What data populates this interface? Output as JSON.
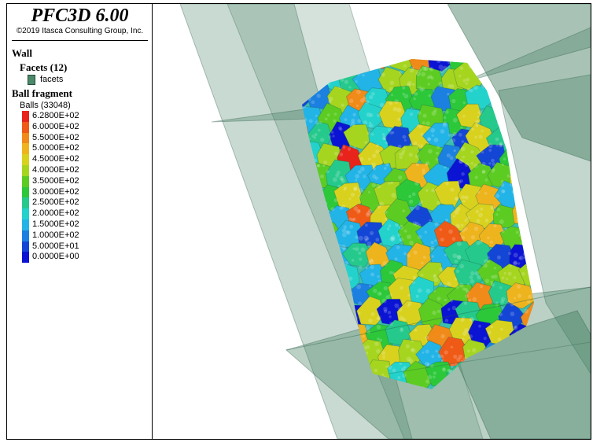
{
  "title": "PFC3D 6.00",
  "copyright": "©2019 Itasca Consulting Group, Inc.",
  "legend": {
    "wall_heading": "Wall",
    "facets_heading": "Facets (12)",
    "facets_label": "facets",
    "facets_color": "#4a8a6a",
    "fragment_heading": "Ball fragment",
    "balls_count": "Balls (33048)",
    "scale": [
      {
        "label": "6.2800E+02",
        "color": "#e8231c"
      },
      {
        "label": "6.0000E+02",
        "color": "#ef5a16"
      },
      {
        "label": "5.5000E+02",
        "color": "#f08a18"
      },
      {
        "label": "5.0000E+02",
        "color": "#eeb41d"
      },
      {
        "label": "4.5000E+02",
        "color": "#d8d21f"
      },
      {
        "label": "4.0000E+02",
        "color": "#a6d51f"
      },
      {
        "label": "3.5000E+02",
        "color": "#5ccc22"
      },
      {
        "label": "3.0000E+02",
        "color": "#2cc83a"
      },
      {
        "label": "2.5000E+02",
        "color": "#25c98c"
      },
      {
        "label": "2.0000E+02",
        "color": "#24d2cc"
      },
      {
        "label": "1.5000E+02",
        "color": "#22b4e6"
      },
      {
        "label": "1.0000E+02",
        "color": "#1b80e0"
      },
      {
        "label": "5.0000E+01",
        "color": "#1446d6"
      },
      {
        "label": "0.0000E+00",
        "color": "#0a14d2"
      }
    ]
  }
}
